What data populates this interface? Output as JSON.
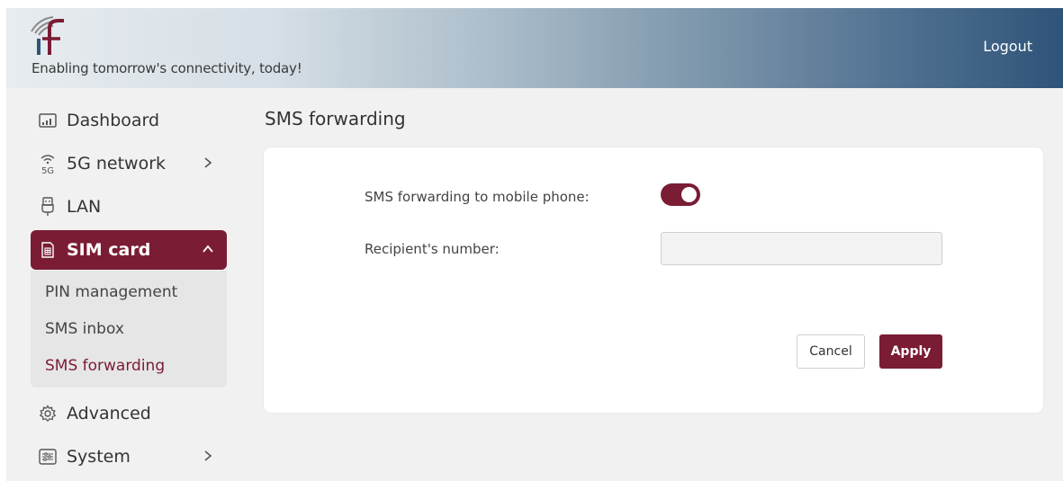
{
  "header": {
    "tagline": "Enabling tomorrow's connectivity, today!",
    "logout_label": "Logout"
  },
  "sidebar": {
    "items": [
      {
        "label": "Dashboard",
        "icon": "dashboard-icon"
      },
      {
        "label": "5G network",
        "icon": "5g-network-icon"
      },
      {
        "label": "LAN",
        "icon": "lan-icon"
      },
      {
        "label": "SIM card",
        "icon": "sim-card-icon"
      },
      {
        "label": "Advanced",
        "icon": "gear-icon"
      },
      {
        "label": "System",
        "icon": "system-icon"
      }
    ],
    "network_badge": "5G",
    "submenu": [
      "PIN management",
      "SMS inbox",
      "SMS forwarding"
    ]
  },
  "main": {
    "title": "SMS forwarding",
    "forwarding_label": "SMS forwarding to mobile phone:",
    "forwarding_enabled": true,
    "recipient_label": "Recipient's number:",
    "recipient_value": "",
    "cancel_label": "Cancel",
    "apply_label": "Apply"
  },
  "colors": {
    "accent": "#7a1c34",
    "header_gradient_start": "#e7ecef",
    "header_gradient_end": "#2f5479"
  }
}
